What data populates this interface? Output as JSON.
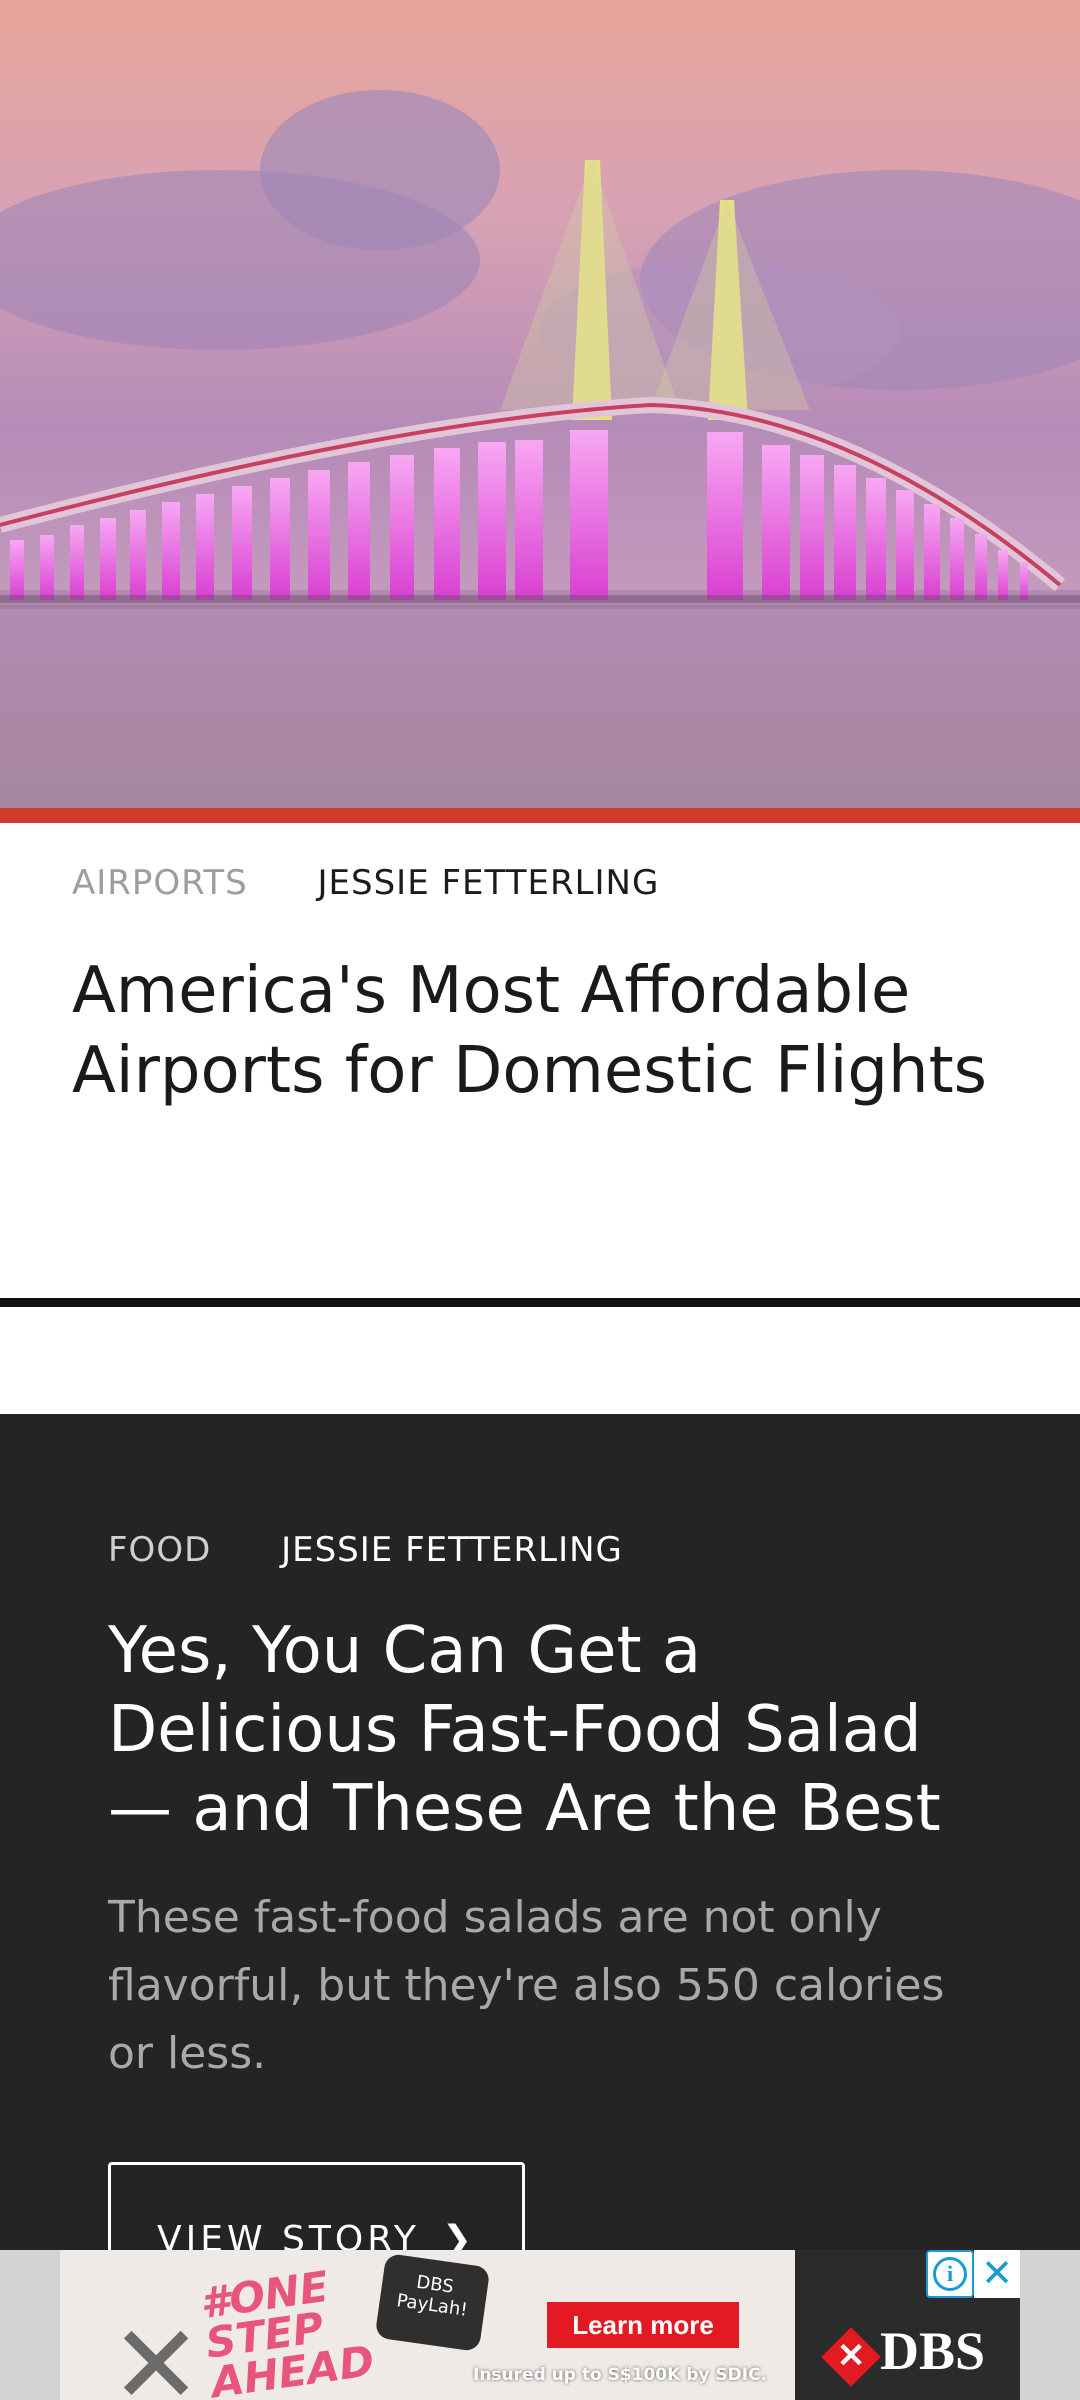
{
  "articles": [
    {
      "category": "AIRPORTS",
      "author": "JESSIE FETTERLING",
      "headline": "America's Most Affordable Airports for Domestic Flights"
    },
    {
      "category": "FOOD",
      "author": "JESSIE FETTERLING",
      "headline": "Yes, You Can Get a Delicious Fast-Food Salad — and These Are the Best",
      "dek": "These fast-food salads are not only flavorful, but they're also 550 calories or less.",
      "cta": "VIEW STORY",
      "cta_icon": "chevron-right-icon"
    }
  ],
  "ad": {
    "slogan": "#ONE STEP AHEAD",
    "sticker": "DBS PayLah!",
    "cta": "Learn more",
    "fine_print": "Insured up to S$100K by SDIC.",
    "brand": "DBS",
    "info_icon": "info-icon",
    "close_icon": "close-icon"
  },
  "colors": {
    "accent_red": "#d23a2c",
    "dark_card": "#242424",
    "ad_red": "#e21a22"
  }
}
